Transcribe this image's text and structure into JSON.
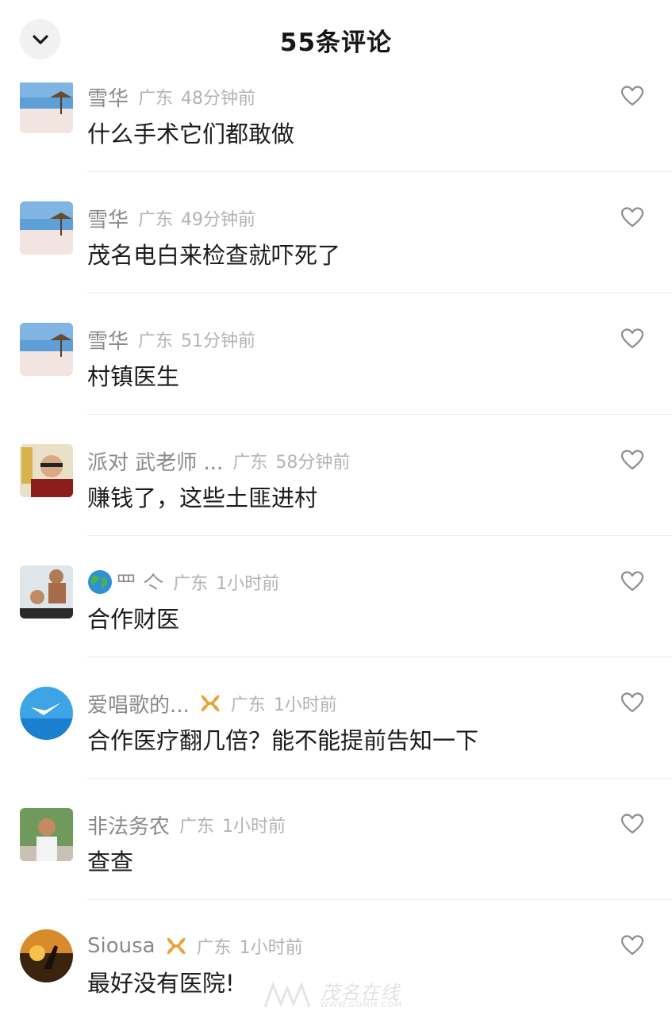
{
  "header": {
    "title": "55条评论",
    "close_icon": "chevron-down-icon"
  },
  "comments": [
    {
      "name": "雪华",
      "location": "广东",
      "time": "48分钟前",
      "text": "什么手术它们都敢做"
    },
    {
      "name": "雪华",
      "location": "广东",
      "time": "49分钟前",
      "text": "茂名电白来检查就吓死了"
    },
    {
      "name": "雪华",
      "location": "广东",
      "time": "51分钟前",
      "text": "村镇医生"
    },
    {
      "name": "派对 武老师 ...",
      "location": "广东",
      "time": "58分钟前",
      "text": "赚钱了，这些土匪进村"
    },
    {
      "name": "罒 亽",
      "location": "广东",
      "time": "1小时前",
      "text": "合作财医"
    },
    {
      "name": "爱唱歌的...",
      "location": "广东",
      "time": "1小时前",
      "text": "合作医疗翻几倍？能不能提前告知一下"
    },
    {
      "name": "非法务农",
      "location": "广东",
      "time": "1小时前",
      "text": "查查"
    },
    {
      "name": "Siousa",
      "location": "广东",
      "time": "1小时前",
      "text": "最好没有医院!"
    }
  ],
  "like_icon": "heart-outline-icon",
  "badge_color": "#e8a23a",
  "watermark": {
    "text": "茂名在线",
    "url": "WWW.GDMM.COM"
  }
}
